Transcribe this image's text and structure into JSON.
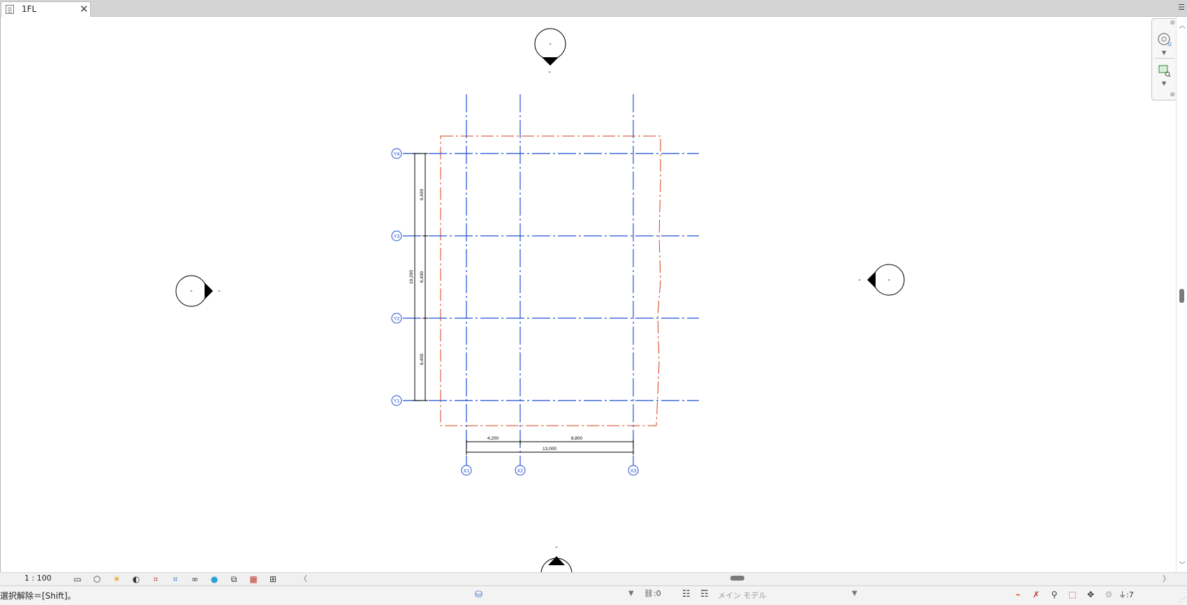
{
  "tab": {
    "label": "1FL"
  },
  "elevations": {
    "north_top": "-",
    "north_bottom": "-",
    "west_inner": "-",
    "west_outer": "-",
    "east_inner": "-",
    "east_outer": "-",
    "south": "-"
  },
  "grids": {
    "y_labels": [
      "Y4",
      "Y3",
      "Y2",
      "Y1"
    ],
    "x_labels": [
      "X1",
      "X2",
      "X3"
    ]
  },
  "dimensions": {
    "y_segments": [
      "6,400",
      "6,400",
      "6,400"
    ],
    "y_total": "19,200",
    "x_segments": [
      "4,200",
      "8,800"
    ],
    "x_total": "13,000"
  },
  "view_controls": {
    "scale": "1 : 100"
  },
  "status": {
    "message": "選択解除＝[Shift]。",
    "link_count": ":0",
    "model": "メイン モデル",
    "filter_count": ":7"
  },
  "colors": {
    "grid": "#1f4fd0",
    "crop": "#d0401a",
    "dim": "#000000"
  }
}
